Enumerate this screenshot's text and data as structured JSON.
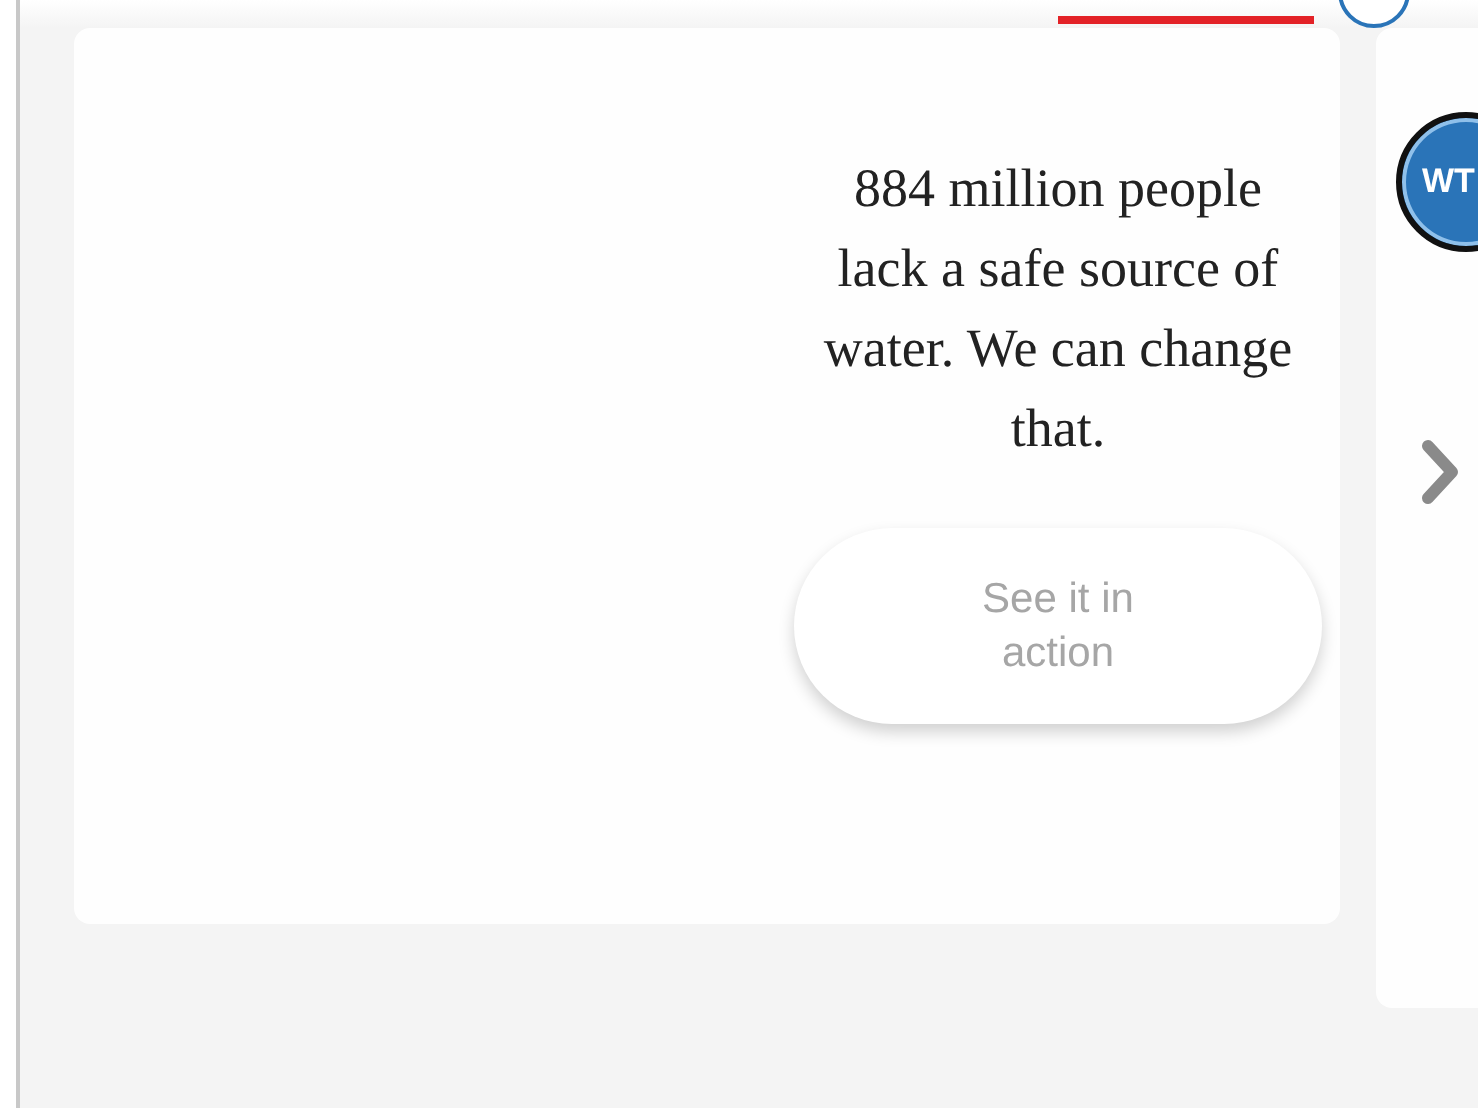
{
  "card": {
    "headline": "884 million people lack a safe source of water. We can change that.",
    "button": "See it in action"
  },
  "next_card": {
    "avatar": "WT"
  }
}
